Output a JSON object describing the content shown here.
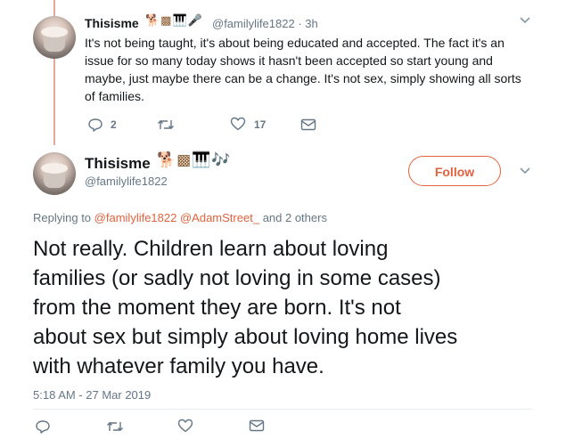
{
  "first_tweet": {
    "display_name": "Thisisme",
    "name_emojis": "🐕▩🎹🎤",
    "handle": "@familylife1822",
    "separator": "·",
    "time": "3h",
    "text_lines": [
      "It's not being taught, it's about being educated and accepted. The fact it's an",
      "issue for so many today shows it hasn't been accepted so start young and",
      "maybe, just maybe there can be a change. It's not sex, simply showing all sorts",
      "of families."
    ],
    "reply_count": "2",
    "retweet_count": "",
    "like_count": "17"
  },
  "main_tweet": {
    "display_name": "Thisisme",
    "name_emojis": "🐕▩🎹🎶",
    "handle": "@familylife1822",
    "follow_label": "Follow",
    "replying_prefix": "Replying to",
    "replying_user_1": "@familylife1822",
    "replying_user_2": "@AdamStreet_",
    "replying_suffix": "and 2 others",
    "text_lines": [
      "Not really. Children learn about loving",
      "families (or sadly not loving in some cases)",
      "from the moment they are born. It's not",
      "about sex but simply about loving home lives",
      "with whatever family you have."
    ],
    "timestamp": "5:18 AM - 27 Mar 2019"
  },
  "icons": {
    "reply": "reply-icon",
    "retweet": "retweet-icon",
    "like": "heart-icon",
    "message": "direct-message-icon",
    "more": "chevron-down-icon"
  },
  "colors": {
    "accent": "#e0623e",
    "thread_line": "#e3a99a",
    "secondary_text": "#657786"
  }
}
